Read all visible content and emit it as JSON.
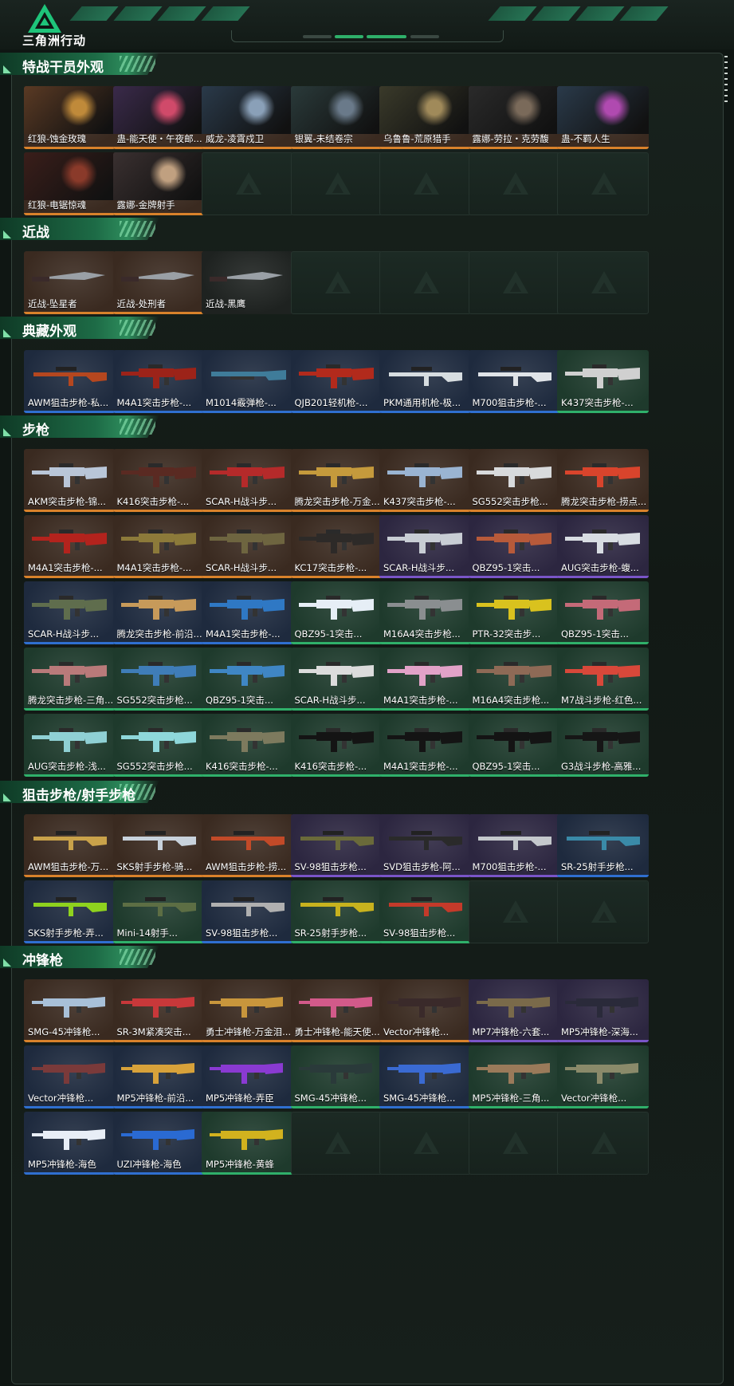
{
  "app": {
    "title": "三角洲行动"
  },
  "colors": {
    "orange": "#d9822b",
    "purple": "#7a55c8",
    "blue": "#2f6fd0",
    "green": "#2fb06a",
    "gray": "#6d7a74"
  },
  "sections": [
    {
      "title": "特战干员外观",
      "rows": 2,
      "items": [
        {
          "label": "红狼-蚀金玫瑰",
          "rarity": "orange",
          "kind": "operator"
        },
        {
          "label": "蛊-能天使・午夜邮...",
          "rarity": "orange",
          "kind": "operator"
        },
        {
          "label": "威龙-凌霄戍卫",
          "rarity": "orange",
          "kind": "operator"
        },
        {
          "label": "银翼-未结卷宗",
          "rarity": "orange",
          "kind": "operator"
        },
        {
          "label": "乌鲁鲁-荒原猎手",
          "rarity": "orange",
          "kind": "operator"
        },
        {
          "label": "露娜-劳拉・克劳馥",
          "rarity": "orange",
          "kind": "operator"
        },
        {
          "label": "蛊-不羁人生",
          "rarity": "orange",
          "kind": "operator"
        },
        {
          "label": "红狼-电锯惊魂",
          "rarity": "orange",
          "kind": "operator"
        },
        {
          "label": "露娜-金牌射手",
          "rarity": "orange",
          "kind": "operator"
        }
      ]
    },
    {
      "title": "近战",
      "rows": 1,
      "items": [
        {
          "label": "近战-坠星者",
          "rarity": "orange",
          "kind": "knife"
        },
        {
          "label": "近战-处刑者",
          "rarity": "orange",
          "kind": "knife"
        },
        {
          "label": "近战-黑鹰",
          "rarity": "none",
          "kind": "knife"
        }
      ]
    },
    {
      "title": "典藏外观",
      "rows": 1,
      "items": [
        {
          "label": "AWM狙击步枪-私...",
          "rarity": "blue",
          "kind": "sniper",
          "gun": "#b5471f"
        },
        {
          "label": "M4A1突击步枪-...",
          "rarity": "blue",
          "kind": "rifle",
          "gun": "#9c2319"
        },
        {
          "label": "M1014霰弹枪-...",
          "rarity": "blue",
          "kind": "shotgun",
          "gun": "#3f7c9a"
        },
        {
          "label": "QJB201轻机枪-...",
          "rarity": "blue",
          "kind": "rifle",
          "gun": "#b22a1c"
        },
        {
          "label": "PKM通用机枪-极...",
          "rarity": "blue",
          "kind": "sniper",
          "gun": "#d7dde0"
        },
        {
          "label": "M700狙击步枪-...",
          "rarity": "blue",
          "kind": "sniper",
          "gun": "#e0e4e8"
        },
        {
          "label": "K437突击步枪-...",
          "rarity": "green",
          "kind": "rifle",
          "gun": "#d0d0d0"
        }
      ]
    },
    {
      "title": "步枪",
      "rows": 5,
      "items": [
        {
          "label": "AKM突击步枪-锦...",
          "rarity": "orange",
          "kind": "rifle",
          "gun": "#b9c6d8"
        },
        {
          "label": "K416突击步枪-...",
          "rarity": "orange",
          "kind": "rifle",
          "gun": "#5a2a22"
        },
        {
          "label": "SCAR-H战斗步...",
          "rarity": "orange",
          "kind": "rifle",
          "gun": "#b52a2a"
        },
        {
          "label": "腾龙突击步枪-万金...",
          "rarity": "orange",
          "kind": "rifle",
          "gun": "#c59a3c"
        },
        {
          "label": "K437突击步枪-...",
          "rarity": "orange",
          "kind": "rifle",
          "gun": "#9ab4d2"
        },
        {
          "label": "SG552突击步枪...",
          "rarity": "orange",
          "kind": "rifle",
          "gun": "#d8dadc"
        },
        {
          "label": "腾龙突击步枪-捞点...",
          "rarity": "orange",
          "kind": "rifle",
          "gun": "#d9442c"
        },
        {
          "label": "M4A1突击步枪-...",
          "rarity": "orange",
          "kind": "rifle",
          "gun": "#b3231d"
        },
        {
          "label": "M4A1突击步枪-...",
          "rarity": "orange",
          "kind": "rifle",
          "gun": "#8c7a3a"
        },
        {
          "label": "SCAR-H战斗步...",
          "rarity": "orange",
          "kind": "rifle",
          "gun": "#6e6540"
        },
        {
          "label": "KC17突击步枪-...",
          "rarity": "orange",
          "kind": "rifle",
          "gun": "#2d2a28"
        },
        {
          "label": "SCAR-H战斗步...",
          "rarity": "purple",
          "kind": "rifle",
          "gun": "#c8cdd4"
        },
        {
          "label": "QBZ95-1突击...",
          "rarity": "purple",
          "kind": "rifle",
          "gun": "#b75a3a"
        },
        {
          "label": "AUG突击步枪-蝮...",
          "rarity": "purple",
          "kind": "rifle",
          "gun": "#d8dde2"
        },
        {
          "label": "SCAR-H战斗步...",
          "rarity": "blue",
          "kind": "rifle",
          "gun": "#5f6d4d"
        },
        {
          "label": "腾龙突击步枪-前沿...",
          "rarity": "blue",
          "kind": "rifle",
          "gun": "#c79a5a"
        },
        {
          "label": "M4A1突击步枪-...",
          "rarity": "blue",
          "kind": "rifle",
          "gun": "#2f78c4"
        },
        {
          "label": "QBZ95-1突击...",
          "rarity": "green",
          "kind": "rifle",
          "gun": "#e6eef6"
        },
        {
          "label": "M16A4突击步枪...",
          "rarity": "green",
          "kind": "rifle",
          "gun": "#8a8e90"
        },
        {
          "label": "PTR-32突击步...",
          "rarity": "green",
          "kind": "rifle",
          "gun": "#d9c21e"
        },
        {
          "label": "QBZ95-1突击...",
          "rarity": "green",
          "kind": "rifle",
          "gun": "#c46a78"
        },
        {
          "label": "腾龙突击步枪-三角...",
          "rarity": "green",
          "kind": "rifle",
          "gun": "#b97a7a"
        },
        {
          "label": "SG552突击步枪...",
          "rarity": "green",
          "kind": "rifle",
          "gun": "#3f7db8"
        },
        {
          "label": "QBZ95-1突击...",
          "rarity": "green",
          "kind": "rifle",
          "gun": "#3f86c4"
        },
        {
          "label": "SCAR-H战斗步...",
          "rarity": "green",
          "kind": "rifle",
          "gun": "#dcdcdc"
        },
        {
          "label": "M4A1突击步枪-...",
          "rarity": "green",
          "kind": "rifle",
          "gun": "#e2a2c8"
        },
        {
          "label": "M16A4突击步枪...",
          "rarity": "green",
          "kind": "rifle",
          "gun": "#8e6a56"
        },
        {
          "label": "M7战斗步枪-红色...",
          "rarity": "green",
          "kind": "rifle",
          "gun": "#d8483a"
        },
        {
          "label": "AUG突击步枪-浅...",
          "rarity": "green",
          "kind": "rifle",
          "gun": "#8fd0d4"
        },
        {
          "label": "SG552突击步枪...",
          "rarity": "green",
          "kind": "rifle",
          "gun": "#8ed7da"
        },
        {
          "label": "K416突击步枪-...",
          "rarity": "green",
          "kind": "rifle",
          "gun": "#7d7a5e"
        },
        {
          "label": "K416突击步枪-...",
          "rarity": "green",
          "kind": "rifle",
          "gun": "#141414"
        },
        {
          "label": "M4A1突击步枪-...",
          "rarity": "green",
          "kind": "rifle",
          "gun": "#141414"
        },
        {
          "label": "QBZ95-1突击...",
          "rarity": "green",
          "kind": "rifle",
          "gun": "#141414"
        },
        {
          "label": "G3战斗步枪-高雅...",
          "rarity": "green",
          "kind": "rifle",
          "gun": "#161616"
        }
      ]
    },
    {
      "title": "狙击步枪/射手步枪",
      "rows": 2,
      "items": [
        {
          "label": "AWM狙击步枪-万...",
          "rarity": "orange",
          "kind": "sniper",
          "gun": "#c9a24a"
        },
        {
          "label": "SKS射手步枪-骑...",
          "rarity": "orange",
          "kind": "sniper",
          "gun": "#c8d2dc"
        },
        {
          "label": "AWM狙击步枪-捞...",
          "rarity": "orange",
          "kind": "sniper",
          "gun": "#c24a28"
        },
        {
          "label": "SV-98狙击步枪...",
          "rarity": "purple",
          "kind": "sniper",
          "gun": "#6a6a3a"
        },
        {
          "label": "SVD狙击步枪-阿...",
          "rarity": "purple",
          "kind": "sniper",
          "gun": "#2a2a2a"
        },
        {
          "label": "M700狙击步枪-...",
          "rarity": "purple",
          "kind": "sniper",
          "gun": "#c4c8cc"
        },
        {
          "label": "SR-25射手步枪...",
          "rarity": "blue",
          "kind": "sniper",
          "gun": "#3a8aa8"
        },
        {
          "label": "SKS射手步枪-弄...",
          "rarity": "blue",
          "kind": "sniper",
          "gun": "#8fd21e"
        },
        {
          "label": "Mini-14射手...",
          "rarity": "green",
          "kind": "sniper",
          "gun": "#5d6e44"
        },
        {
          "label": "SV-98狙击步枪...",
          "rarity": "blue",
          "kind": "sniper",
          "gun": "#b0b0b0"
        },
        {
          "label": "SR-25射手步枪...",
          "rarity": "green",
          "kind": "sniper",
          "gun": "#c8b21e"
        },
        {
          "label": "SV-98狙击步枪...",
          "rarity": "green",
          "kind": "sniper",
          "gun": "#c43a2a"
        }
      ]
    },
    {
      "title": "冲锋枪",
      "rows": 3,
      "items": [
        {
          "label": "SMG-45冲锋枪...",
          "rarity": "orange",
          "kind": "smg",
          "gun": "#a8c0d8"
        },
        {
          "label": "SR-3M紧凑突击...",
          "rarity": "orange",
          "kind": "smg",
          "gun": "#c8383a"
        },
        {
          "label": "勇士冲锋枪-万金泪...",
          "rarity": "orange",
          "kind": "smg",
          "gun": "#c8963c"
        },
        {
          "label": "勇士冲锋枪-能天使...",
          "rarity": "orange",
          "kind": "smg",
          "gun": "#d25a8a"
        },
        {
          "label": "Vector冲锋枪...",
          "rarity": "orange",
          "kind": "smg",
          "gun": "#3a2a2a"
        },
        {
          "label": "MP7冲锋枪-六套...",
          "rarity": "purple",
          "kind": "smg",
          "gun": "#7a6a4a"
        },
        {
          "label": "MP5冲锋枪-深海...",
          "rarity": "purple",
          "kind": "smg",
          "gun": "#2a2a3a"
        },
        {
          "label": "Vector冲锋枪...",
          "rarity": "blue",
          "kind": "smg",
          "gun": "#7a3a3a"
        },
        {
          "label": "MP5冲锋枪-前沿...",
          "rarity": "blue",
          "kind": "smg",
          "gun": "#d8a23a"
        },
        {
          "label": "MP5冲锋枪-弄臣",
          "rarity": "blue",
          "kind": "smg",
          "gun": "#8a3ad2"
        },
        {
          "label": "SMG-45冲锋枪...",
          "rarity": "green",
          "kind": "smg",
          "gun": "#2a3a3a"
        },
        {
          "label": "SMG-45冲锋枪...",
          "rarity": "blue",
          "kind": "smg",
          "gun": "#3a6ad2"
        },
        {
          "label": "MP5冲锋枪-三角...",
          "rarity": "green",
          "kind": "smg",
          "gun": "#9a7a5a"
        },
        {
          "label": "Vector冲锋枪...",
          "rarity": "green",
          "kind": "smg",
          "gun": "#8a8a6a"
        },
        {
          "label": "MP5冲锋枪-海色",
          "rarity": "blue",
          "kind": "smg",
          "gun": "#e8eef6"
        },
        {
          "label": "UZI冲锋枪-海色",
          "rarity": "blue",
          "kind": "smg",
          "gun": "#2a6ad2"
        },
        {
          "label": "MP5冲锋枪-黄蜂",
          "rarity": "green",
          "kind": "smg",
          "gun": "#d2b21e"
        }
      ]
    }
  ]
}
